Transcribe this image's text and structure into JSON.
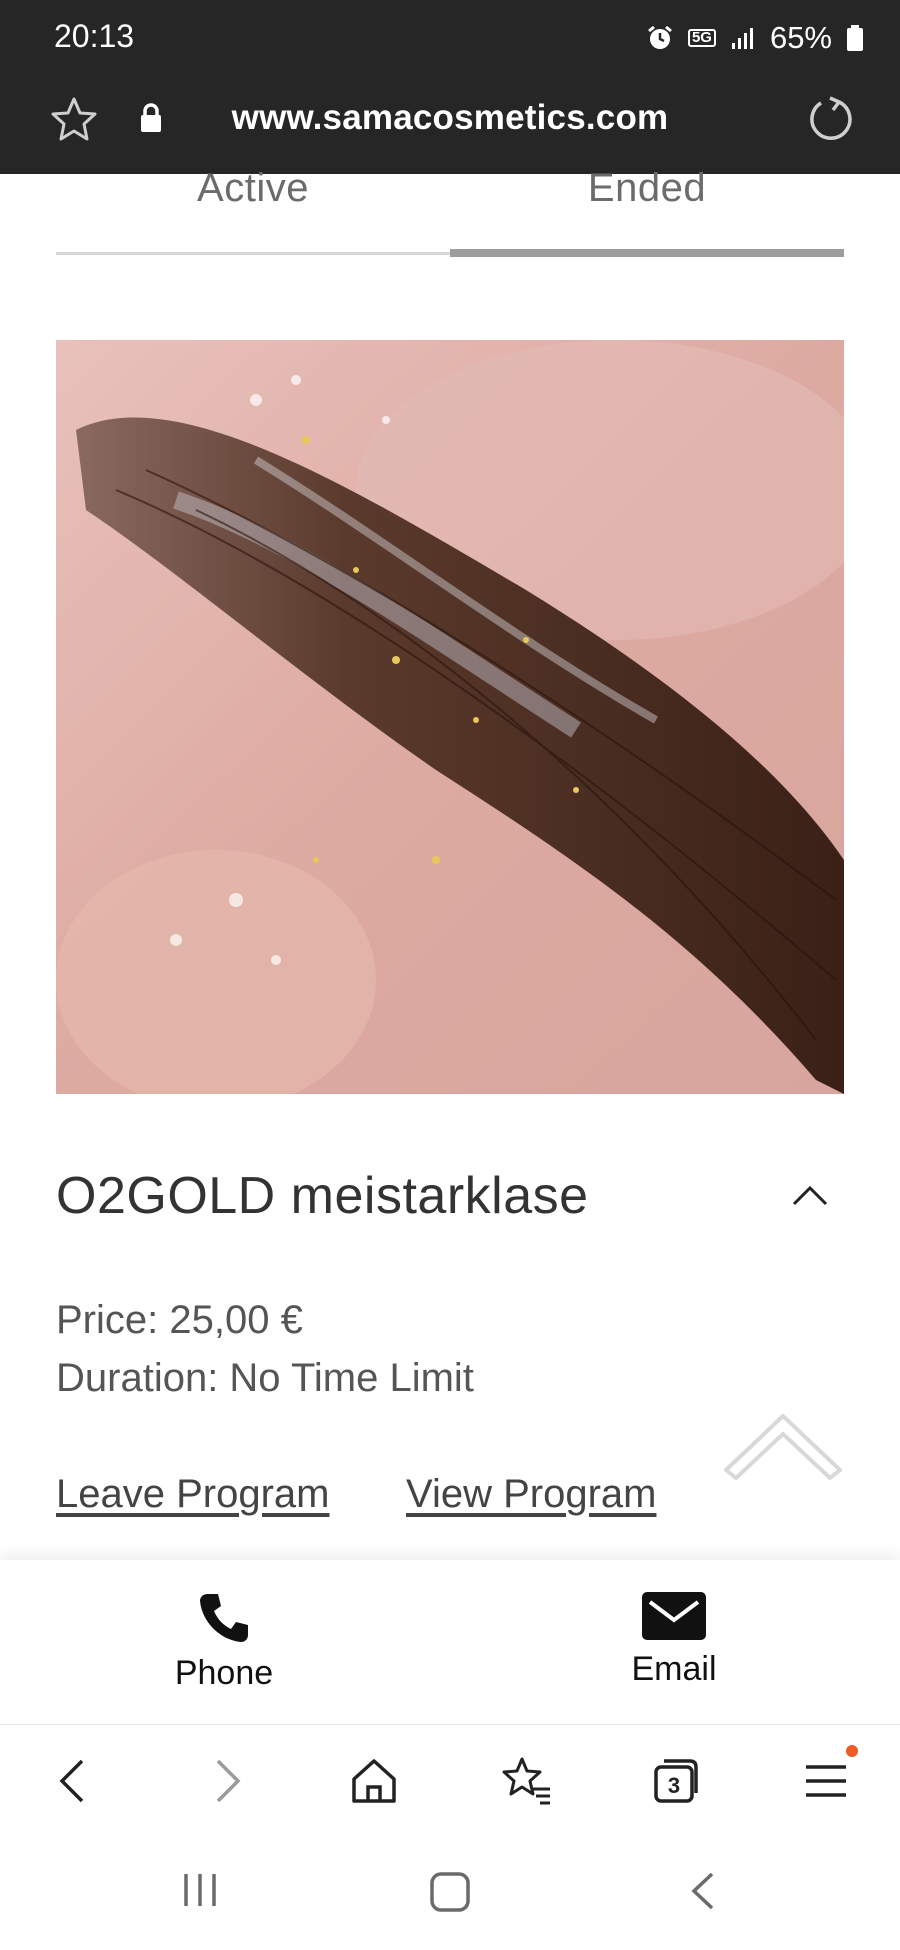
{
  "status_bar": {
    "time": "20:13",
    "network": "5G",
    "battery": "65%"
  },
  "browser": {
    "url": "www.samacosmetics.com",
    "tab_count": "3"
  },
  "tabs": [
    {
      "label": "Active",
      "selected": false
    },
    {
      "label": "Ended",
      "selected": true
    }
  ],
  "program": {
    "title": "O2GOLD meistarklase",
    "price": "Price: 25,00 €",
    "duration": "Duration: No Time Limit",
    "leave_label": "Leave Program",
    "view_label": "View Program"
  },
  "contact": {
    "phone_label": "Phone",
    "email_label": "Email"
  },
  "colors": {
    "topbar": "#262626",
    "tab_indicator": "#9d9d9d",
    "menu_badge": "#f15a22"
  },
  "icons": {
    "url_bar": [
      "star-icon",
      "lock-icon",
      "reload-icon"
    ],
    "nav": [
      "back-icon",
      "forward-icon",
      "home-icon",
      "bookmarks-icon",
      "tabs-icon",
      "menu-icon"
    ],
    "system": [
      "recents-icon",
      "home-button-icon",
      "system-back-icon"
    ]
  }
}
